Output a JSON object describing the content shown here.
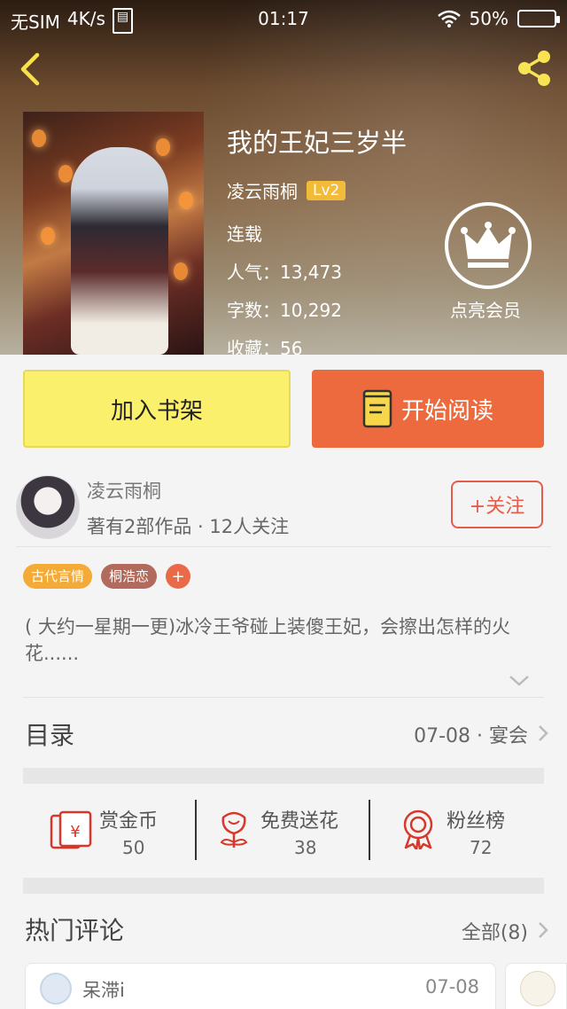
{
  "status_bar": {
    "carrier": "无SIM",
    "speed": "4K/s",
    "time": "01:17",
    "battery": "50%"
  },
  "book": {
    "title": "我的王妃三岁半",
    "author": "凌云雨桐",
    "level": "Lv2",
    "status": "连载",
    "popularity_label": "人气：",
    "popularity": "13,473",
    "words_label": "字数：",
    "words": "10,292",
    "favorites_label": "收藏：",
    "favorites": "56",
    "vip_label": "点亮会员"
  },
  "actions": {
    "add_shelf": "加入书架",
    "start_read": "开始阅读"
  },
  "author_card": {
    "name": "凌云雨桐",
    "meta": "著有2部作品 · 12人关注",
    "follow": "+关注"
  },
  "tags": [
    "古代言情",
    "桐浩恋"
  ],
  "tag_add": "+",
  "description": "( 大约一星期一更)冰冷王爷碰上装傻王妃，会擦出怎样的火花......",
  "toc": {
    "title": "目录",
    "latest": "07-08 · 宴会"
  },
  "stats": [
    {
      "label": "赏金币",
      "value": "50",
      "icon": "red-envelope-icon"
    },
    {
      "label": "免费送花",
      "value": "38",
      "icon": "flower-icon"
    },
    {
      "label": "粉丝榜",
      "value": "72",
      "icon": "medal-icon"
    }
  ],
  "comments": {
    "title": "热门评论",
    "all": "全部(8)",
    "first_name": "呆滞i",
    "first_date": "07-08"
  },
  "colors": {
    "accent": "#ec6a3d",
    "shelf": "#fbf06b",
    "follow": "#e55d4a",
    "level": "#f2b62a"
  }
}
